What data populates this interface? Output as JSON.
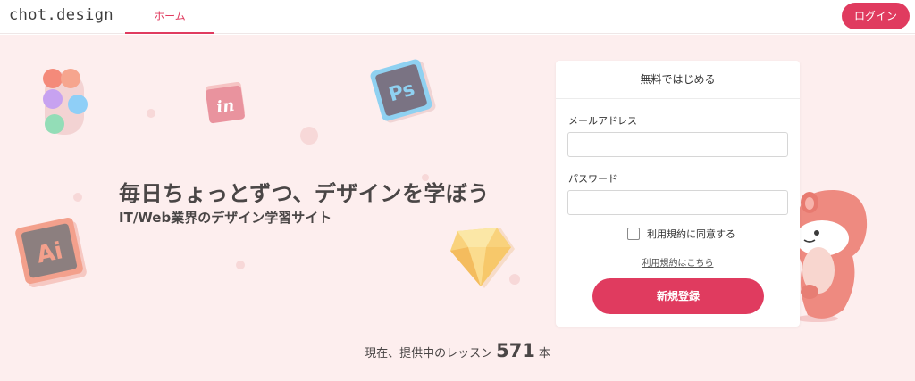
{
  "header": {
    "logo": "chot.design",
    "nav": {
      "home_label": "ホーム"
    },
    "login_label": "ログイン"
  },
  "hero": {
    "headline": "毎日ちょっとずつ、デザインを学ぼう",
    "subline": "IT/Web業界のデザイン学習サイト",
    "lessons": {
      "prefix": "現在、提供中のレッスン",
      "count": "571",
      "suffix": "本"
    },
    "icons": {
      "invision": "in",
      "photoshop": "Ps",
      "illustrator": "Ai"
    }
  },
  "signup_form": {
    "title": "無料ではじめる",
    "email_label": "メールアドレス",
    "email_value": "",
    "password_label": "パスワード",
    "password_value": "",
    "agree_label": "利用規約に同意する",
    "agree_checked": false,
    "terms_link": "利用規約はこちら",
    "submit_label": "新規登録"
  },
  "colors": {
    "accent": "#e03b5f",
    "hero_bg": "#fdeeee",
    "text": "#4a4646"
  }
}
